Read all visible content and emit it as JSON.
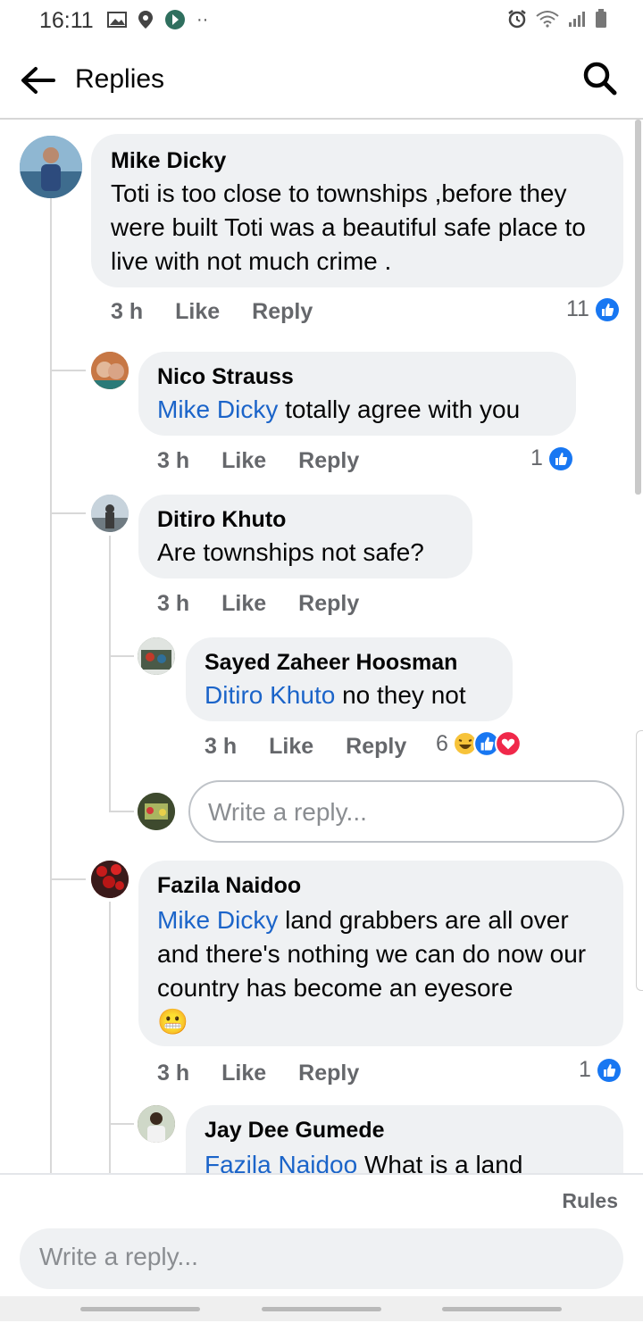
{
  "status_bar": {
    "time": "16:11"
  },
  "header": {
    "title": "Replies"
  },
  "comments": [
    {
      "author": "Mike Dicky",
      "text": "Toti is too close to townships ,before they were built Toti was a beautiful safe place to live with not much crime .",
      "time": "3 h",
      "like": "Like",
      "reply": "Reply",
      "reactions": "11"
    },
    {
      "author": "Nico Strauss",
      "mention": "Mike Dicky",
      "text": " totally agree with you",
      "time": "3 h",
      "like": "Like",
      "reply": "Reply",
      "reactions": "1"
    },
    {
      "author": "Ditiro Khuto",
      "text": "Are townships not safe?",
      "time": "3 h",
      "like": "Like",
      "reply": "Reply"
    },
    {
      "author": "Sayed Zaheer Hoosman",
      "mention": "Ditiro Khuto",
      "text": " no they not",
      "time": "3 h",
      "like": "Like",
      "reply": "Reply",
      "reactions": "6"
    },
    {
      "author": "Fazila Naidoo",
      "mention": "Mike Dicky",
      "text": " land grabbers are all over and there's nothing we can do now our country has become an eyesore",
      "emoji": "😬",
      "time": "3 h",
      "like": "Like",
      "reply": "Reply",
      "reactions": "1"
    },
    {
      "author": "Jay Dee Gumede",
      "mention": "Fazila Naidoo",
      "text": " What is a land"
    }
  ],
  "inline_reply": {
    "placeholder": "Write a reply..."
  },
  "footer": {
    "rules": "Rules",
    "placeholder": "Write a reply..."
  }
}
